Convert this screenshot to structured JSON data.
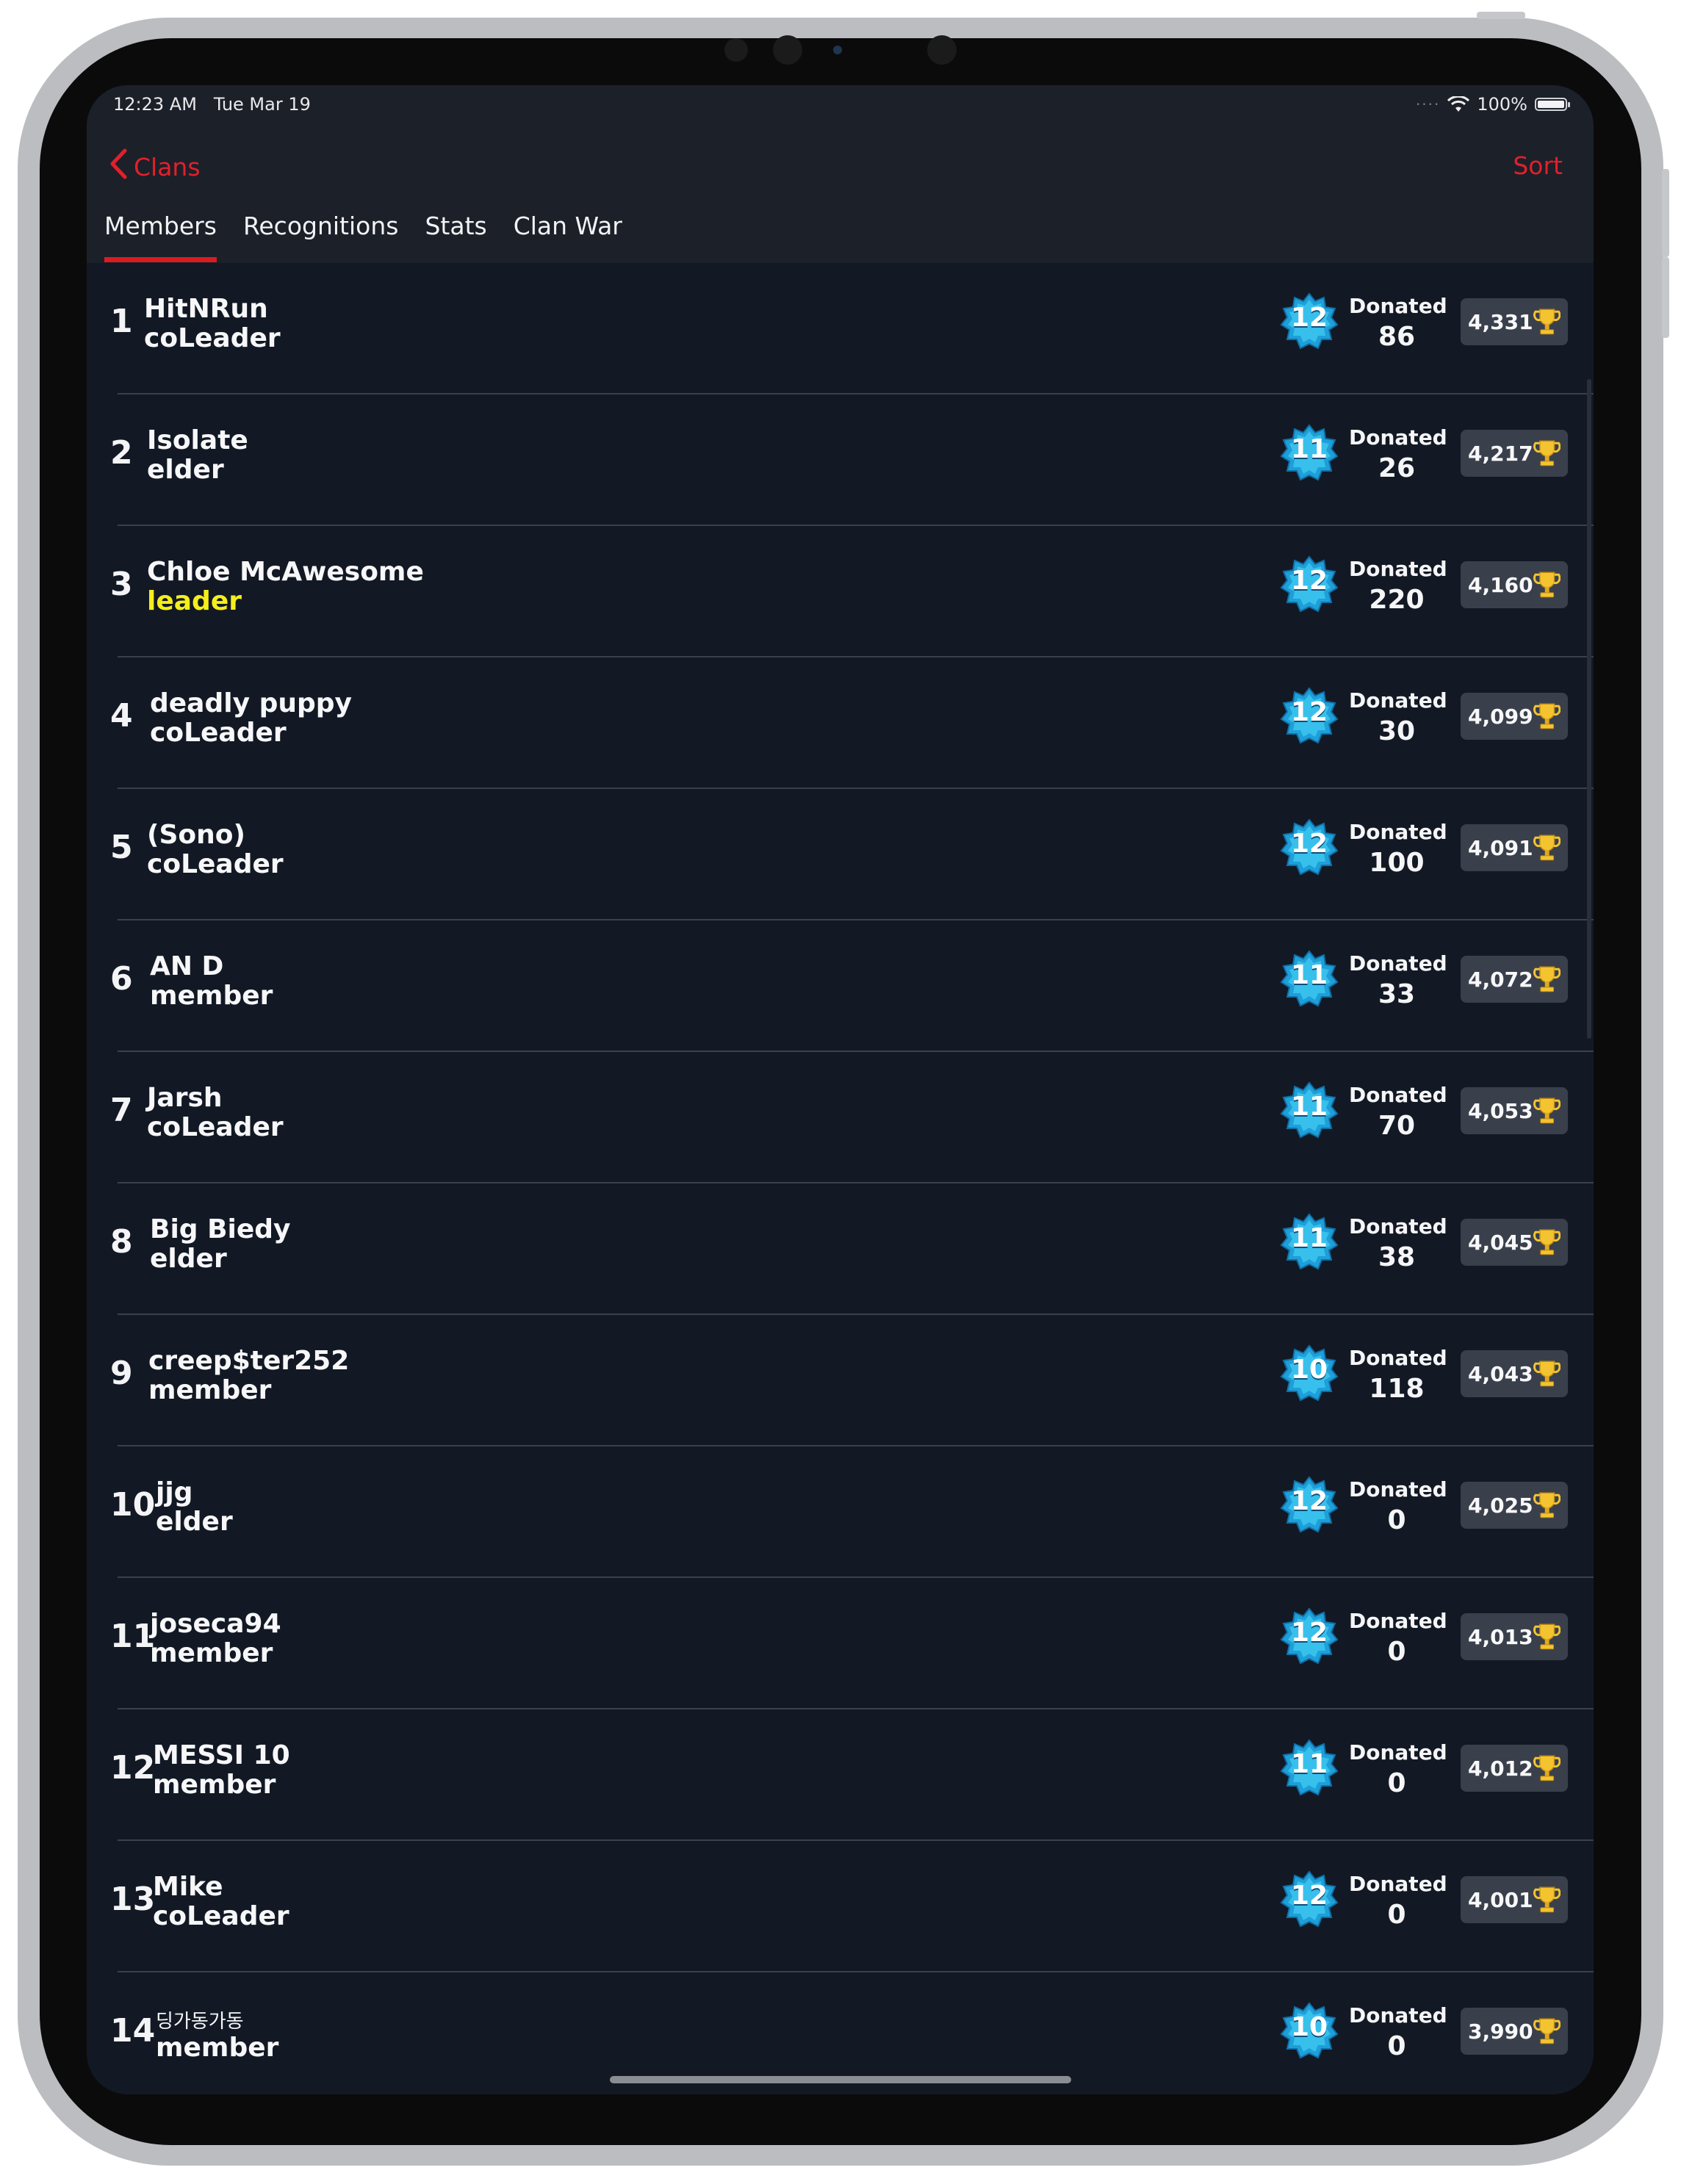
{
  "status_bar": {
    "time": "12:23 AM",
    "date": "Tue Mar 19",
    "battery": "100%"
  },
  "nav": {
    "back_label": "Clans",
    "sort_label": "Sort"
  },
  "tabs": [
    {
      "label": "Members",
      "active": true
    },
    {
      "label": "Recognitions",
      "active": false
    },
    {
      "label": "Stats",
      "active": false
    },
    {
      "label": "Clan War",
      "active": false
    }
  ],
  "donated_label": "Donated",
  "colors": {
    "accent": "#e2202a",
    "leader_role": "#f5ee1b",
    "background": "#121924",
    "header": "#1c2029"
  },
  "members": [
    {
      "rank": "1",
      "name": "HitNRun",
      "role": "coLeader",
      "level": "12",
      "donated": "86",
      "trophies": "4,331"
    },
    {
      "rank": "2",
      "name": "Isolate",
      "role": "elder",
      "level": "11",
      "donated": "26",
      "trophies": "4,217"
    },
    {
      "rank": "3",
      "name": "Chloe McAwesome",
      "role": "leader",
      "level": "12",
      "donated": "220",
      "trophies": "4,160"
    },
    {
      "rank": "4",
      "name": "deadly puppy",
      "role": "coLeader",
      "level": "12",
      "donated": "30",
      "trophies": "4,099"
    },
    {
      "rank": "5",
      "name": "(Sono)",
      "role": "coLeader",
      "level": "12",
      "donated": "100",
      "trophies": "4,091"
    },
    {
      "rank": "6",
      "name": "AN D",
      "role": "member",
      "level": "11",
      "donated": "33",
      "trophies": "4,072"
    },
    {
      "rank": "7",
      "name": "Jarsh",
      "role": "coLeader",
      "level": "11",
      "donated": "70",
      "trophies": "4,053"
    },
    {
      "rank": "8",
      "name": "Big Biedy",
      "role": "elder",
      "level": "11",
      "donated": "38",
      "trophies": "4,045"
    },
    {
      "rank": "9",
      "name": "creep$ter252",
      "role": "member",
      "level": "10",
      "donated": "118",
      "trophies": "4,043"
    },
    {
      "rank": "10",
      "name": "jjg",
      "role": "elder",
      "level": "12",
      "donated": "0",
      "trophies": "4,025"
    },
    {
      "rank": "11",
      "name": "joseca94",
      "role": "member",
      "level": "12",
      "donated": "0",
      "trophies": "4,013"
    },
    {
      "rank": "12",
      "name": "MESSI 10",
      "role": "member",
      "level": "11",
      "donated": "0",
      "trophies": "4,012"
    },
    {
      "rank": "13",
      "name": "Mike",
      "role": "coLeader",
      "level": "12",
      "donated": "0",
      "trophies": "4,001"
    },
    {
      "rank": "14",
      "name": "딩가동가동",
      "role": "member",
      "level": "10",
      "donated": "0",
      "trophies": "3,990"
    }
  ]
}
